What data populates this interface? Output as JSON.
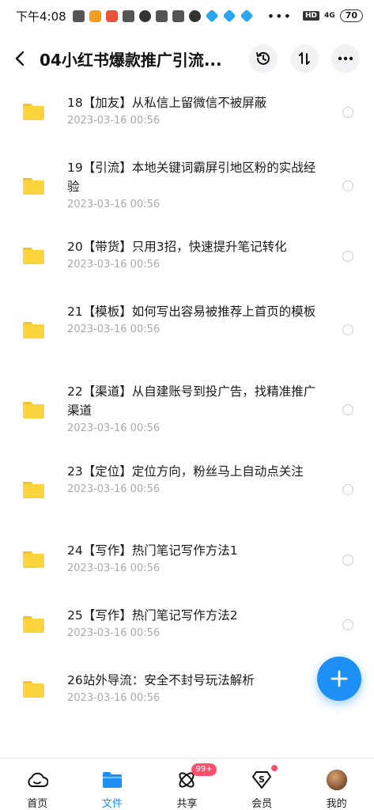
{
  "status_bar": {
    "time": "下午4:08",
    "dots": "•••",
    "hd": "HD",
    "network": "4G",
    "battery": "70"
  },
  "header": {
    "title": "04小红书爆款推广引流...",
    "icons": [
      "back-icon",
      "history-icon",
      "sort-icon",
      "more-icon"
    ]
  },
  "items": [
    {
      "title": "18【加友】从私信上留微信不被屏蔽",
      "date": "2023-03-16  00:56"
    },
    {
      "title": "19【引流】本地关键词霸屏引地区粉的实战经验",
      "date": "2023-03-16  00:56"
    },
    {
      "title": "20【带货】只用3招，快速提升笔记转化",
      "date": "2023-03-16  00:56"
    },
    {
      "title": "21【模板】如何写出容易被推荐上首页的模板",
      "date": "2023-03-16  00:56"
    },
    {
      "title": "22【渠道】从自建账号到投广告，找精准推广渠道",
      "date": "2023-03-16  00:56"
    },
    {
      "title": "23【定位】定位方向，粉丝马上自动点关注",
      "date": "2023-03-16  00:56"
    },
    {
      "title": "24【写作】热门笔记写作方法1",
      "date": "2023-03-16  00:56"
    },
    {
      "title": "25【写作】热门笔记写作方法2",
      "date": "2023-03-16  00:56"
    },
    {
      "title": "26站外导流：安全不封号玩法解析",
      "date": "2023-03-16  00:56"
    }
  ],
  "fab": {
    "icon": "plus-icon",
    "color": "#1e90f5"
  },
  "bottom_nav": {
    "home": "首页",
    "files": "文件",
    "share": "共享",
    "share_badge": "99+",
    "vip": "会员",
    "mine": "我的"
  },
  "colors": {
    "accent": "#1e90f5",
    "folder": "#fbd33d",
    "badge": "#ff4f6d"
  }
}
